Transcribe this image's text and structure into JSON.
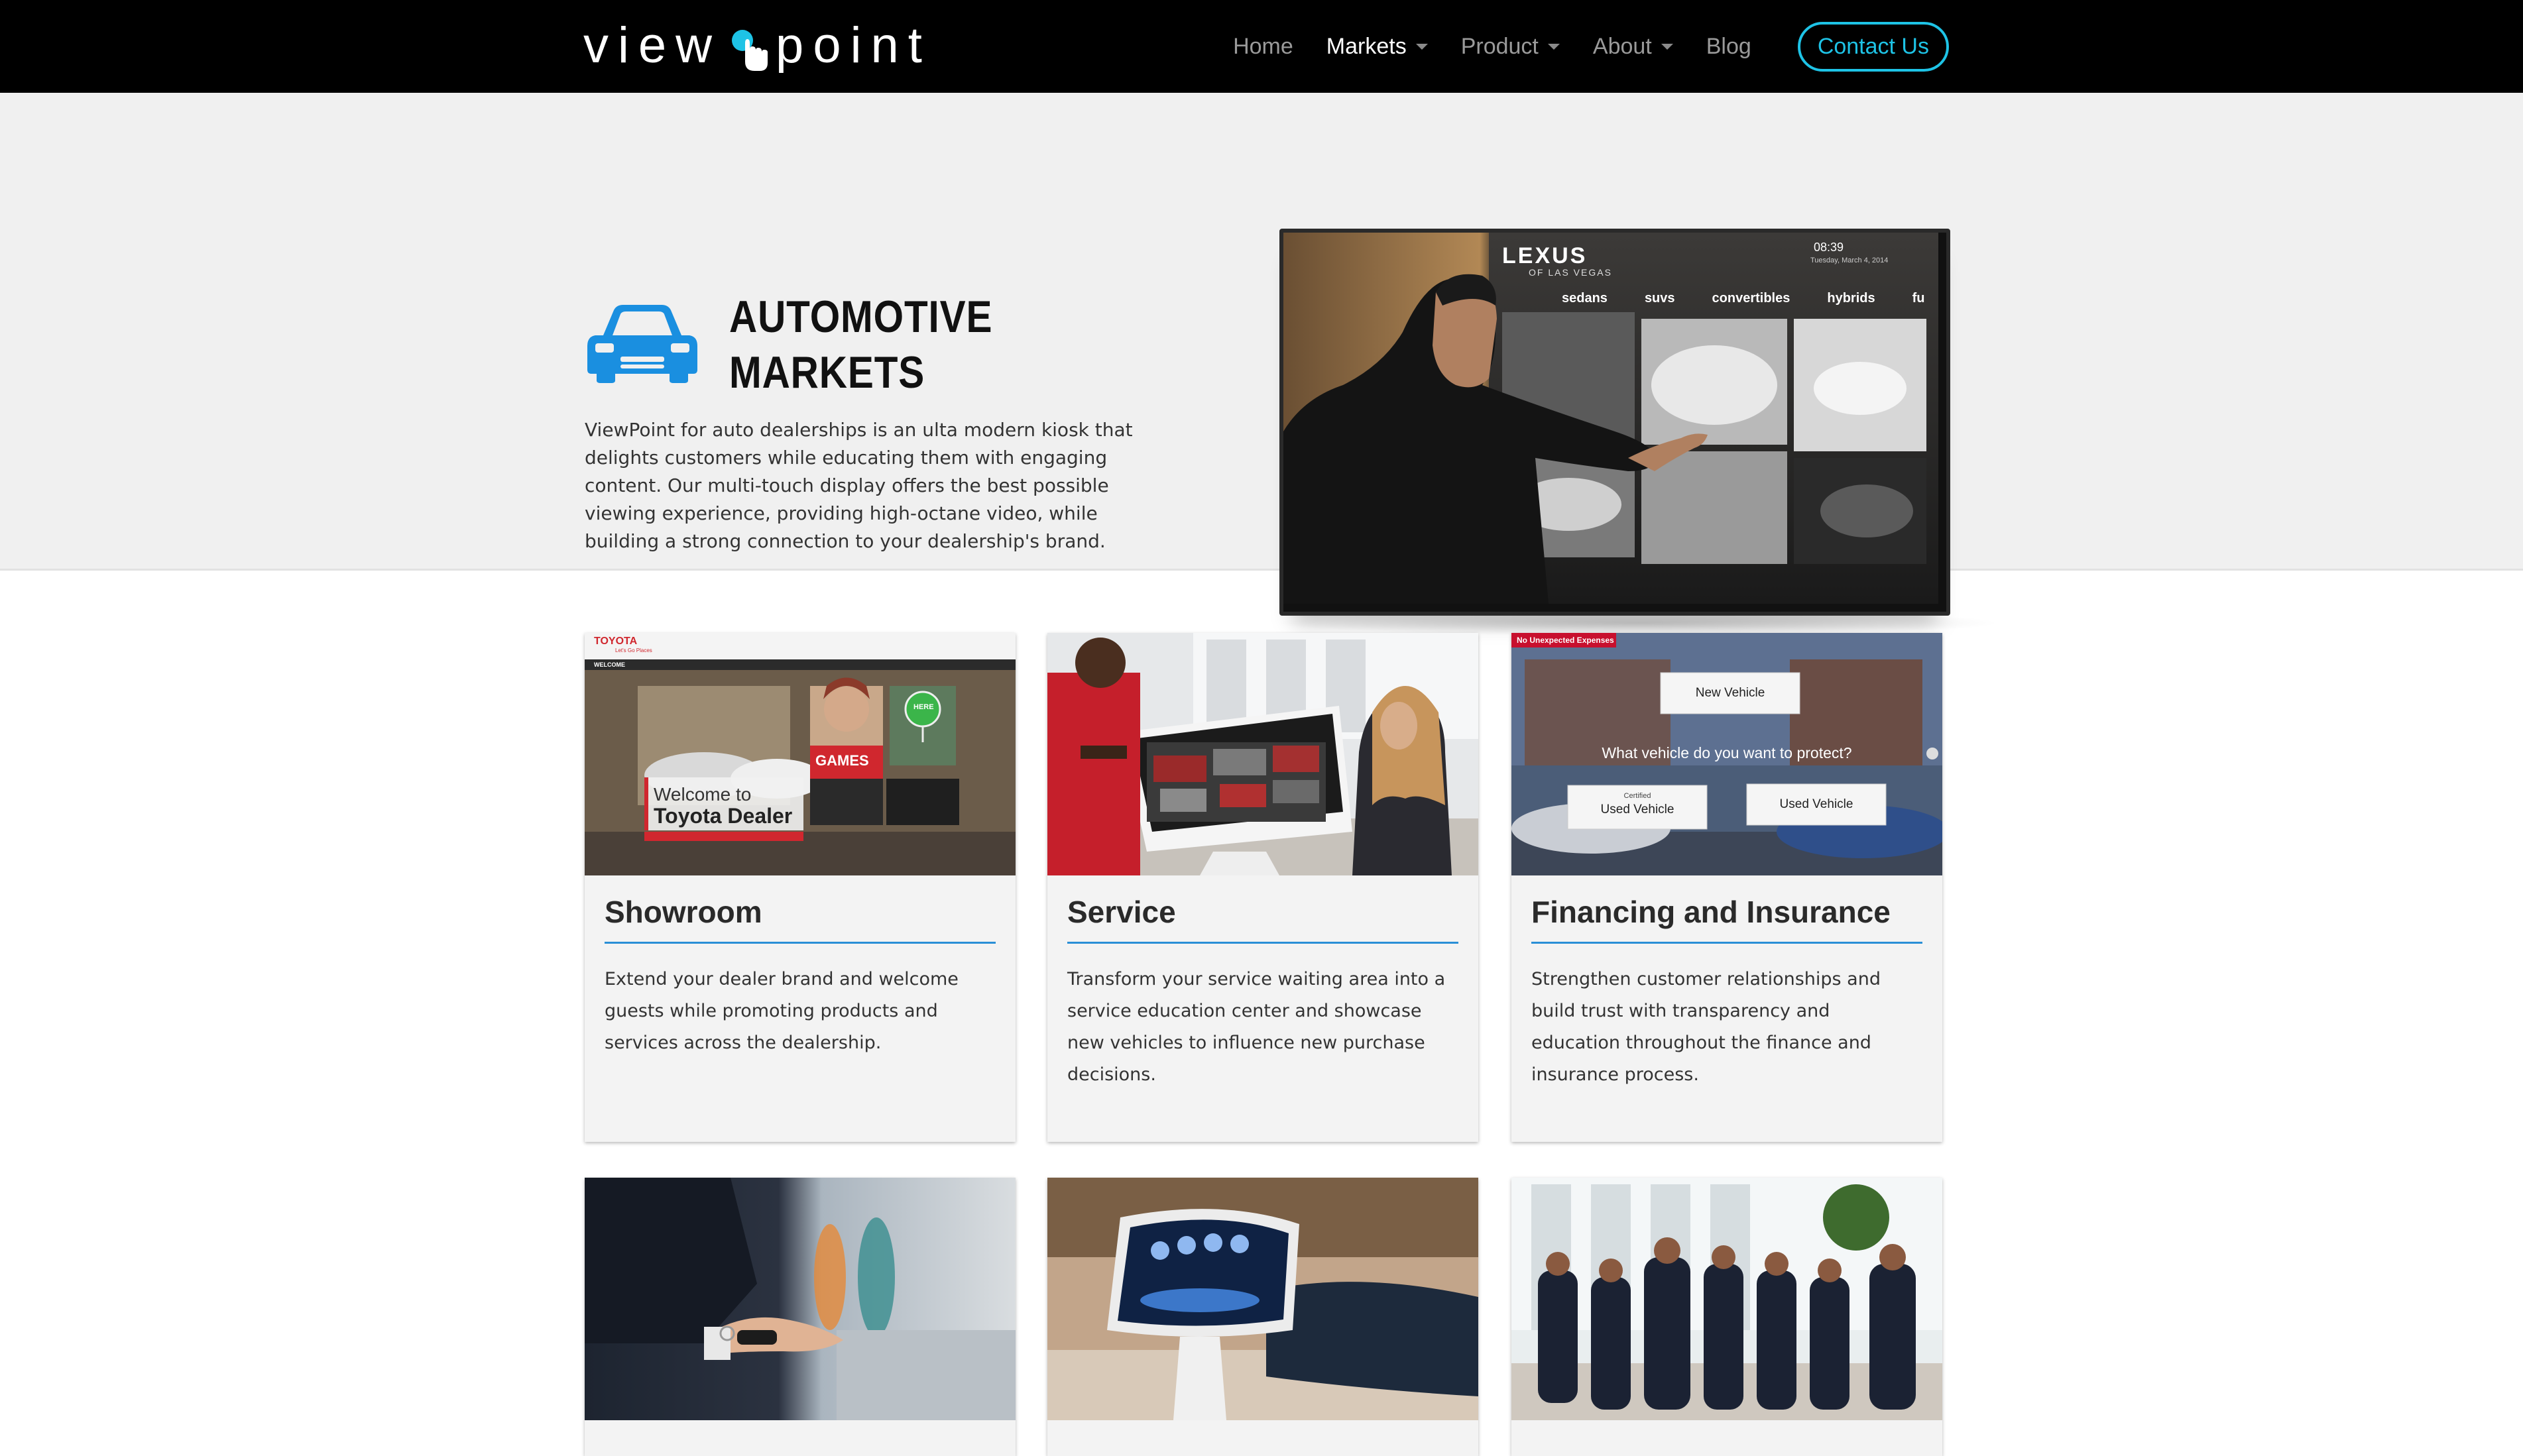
{
  "header": {
    "logo_left": "view",
    "logo_right": "point",
    "nav": [
      {
        "label": "Home",
        "dropdown": false,
        "active": false
      },
      {
        "label": "Markets",
        "dropdown": true,
        "active": true
      },
      {
        "label": "Product",
        "dropdown": true,
        "active": false
      },
      {
        "label": "About",
        "dropdown": true,
        "active": false
      },
      {
        "label": "Blog",
        "dropdown": false,
        "active": false
      }
    ],
    "contact_label": "Contact Us",
    "accent": "#1ec3e6"
  },
  "hero": {
    "icon": "car-icon",
    "icon_color": "#1a8fe0",
    "title_line1": "AUTOMOTIVE",
    "title_line2": "MARKETS",
    "text": "ViewPoint for auto dealerships is an ulta modern kiosk that delights customers while educating them with engaging content. Our multi-touch display offers the best possible viewing experience, providing high-octane video, while building a strong connection to your dealership's brand.",
    "screen": {
      "brand": "LEXUS",
      "brand_sub": "OF LAS VEGAS",
      "time": "08:39",
      "date": "Tuesday, March 4, 2014",
      "tabs": [
        "sedans",
        "suvs",
        "convertibles",
        "hybrids",
        "fu"
      ]
    }
  },
  "cards": [
    {
      "title": "Showroom",
      "text": "Extend your dealer brand and welcome guests while promoting products and services across the dealership.",
      "image": {
        "brand": "TOYOTA",
        "tagline": "Let's Go Places",
        "welcome_small": "Welcome to",
        "welcome_big": "Toyota Dealer",
        "games": "GAMES",
        "pin": "HERE",
        "menu_label": "WELCOME"
      }
    },
    {
      "title": "Service",
      "text": "Transform your service waiting area into a service education center and showcase new vehicles to influence new purchase decisions."
    },
    {
      "title": "Financing and Insurance",
      "text": "Strengthen customer relationships and build trust with transparency and education throughout the finance and insurance process.",
      "image": {
        "banner": "No Unexpected Expenses",
        "new_vehicle": "New Vehicle",
        "question": "What vehicle do you want to protect?",
        "certified_small": "Certified",
        "used_vehicle_1": "Used Vehicle",
        "used_vehicle_2": "Used Vehicle"
      }
    }
  ],
  "colors": {
    "card_rule": "#2a8fd6",
    "hero_bg": "#f0f0f0",
    "card_bg": "#f3f3f3"
  }
}
